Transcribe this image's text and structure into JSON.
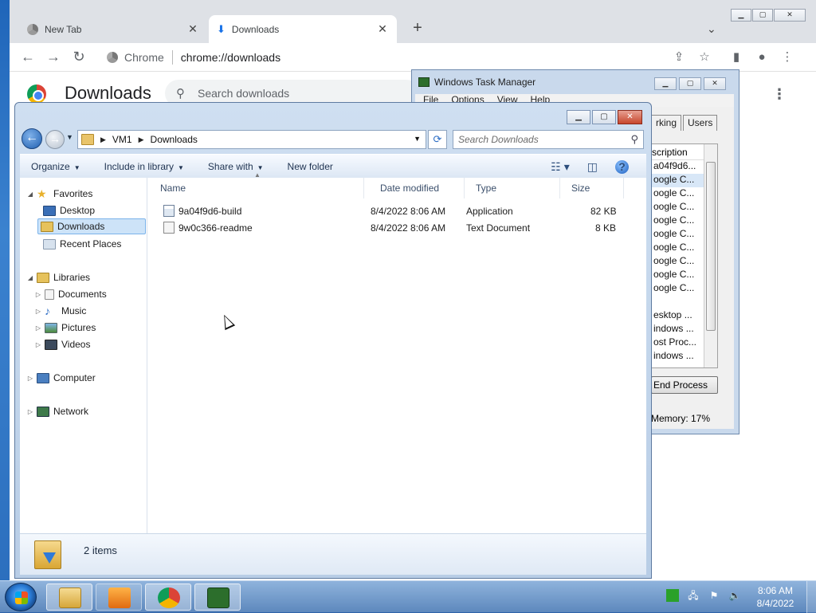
{
  "chrome": {
    "tabs": [
      {
        "title": "New Tab",
        "icon": "chrome-icon"
      },
      {
        "title": "Downloads",
        "icon": "download-icon"
      }
    ],
    "address": {
      "site_chip": "Chrome",
      "url": "chrome://downloads"
    },
    "downloads_page": {
      "title": "Downloads",
      "search_placeholder": "Search downloads"
    }
  },
  "taskmgr": {
    "title": "Windows Task Manager",
    "menu": [
      "File",
      "Options",
      "View",
      "Help"
    ],
    "tabs_visible": [
      "rking",
      "Users"
    ],
    "column": "scription",
    "rows": [
      "a04f9d6...",
      "oogle C...",
      "oogle C...",
      "oogle C...",
      "oogle C...",
      "oogle C...",
      "oogle C...",
      "oogle C...",
      "oogle C...",
      "oogle C...",
      "",
      "esktop ...",
      "indows ...",
      "ost Proc...",
      "indows ..."
    ],
    "end_process": "End Process",
    "status": "Memory: 17%"
  },
  "explorer": {
    "breadcrumb": [
      "VM1",
      "Downloads"
    ],
    "search_placeholder": "Search Downloads",
    "commands": [
      "Organize",
      "Include in library",
      "Share with",
      "New folder"
    ],
    "nav": {
      "favorites": {
        "label": "Favorites",
        "items": [
          "Desktop",
          "Downloads",
          "Recent Places"
        ]
      },
      "libraries": {
        "label": "Libraries",
        "items": [
          "Documents",
          "Music",
          "Pictures",
          "Videos"
        ]
      },
      "computer": "Computer",
      "network": "Network"
    },
    "columns": [
      "Name",
      "Date modified",
      "Type",
      "Size"
    ],
    "files": [
      {
        "name": "9a04f9d6-build",
        "date": "8/4/2022 8:06 AM",
        "type": "Application",
        "size": "82 KB"
      },
      {
        "name": "9w0c366-readme",
        "date": "8/4/2022 8:06 AM",
        "type": "Text Document",
        "size": "8 KB"
      }
    ],
    "item_count": "2 items"
  },
  "taskbar": {
    "apps": [
      "explorer",
      "media-player",
      "chrome",
      "task-manager"
    ],
    "time": "8:06 AM",
    "date": "8/4/2022"
  },
  "colors": {
    "selection": "#cde3f8",
    "desktop": "#1f65b9",
    "taskbar": "#5d88bd"
  }
}
